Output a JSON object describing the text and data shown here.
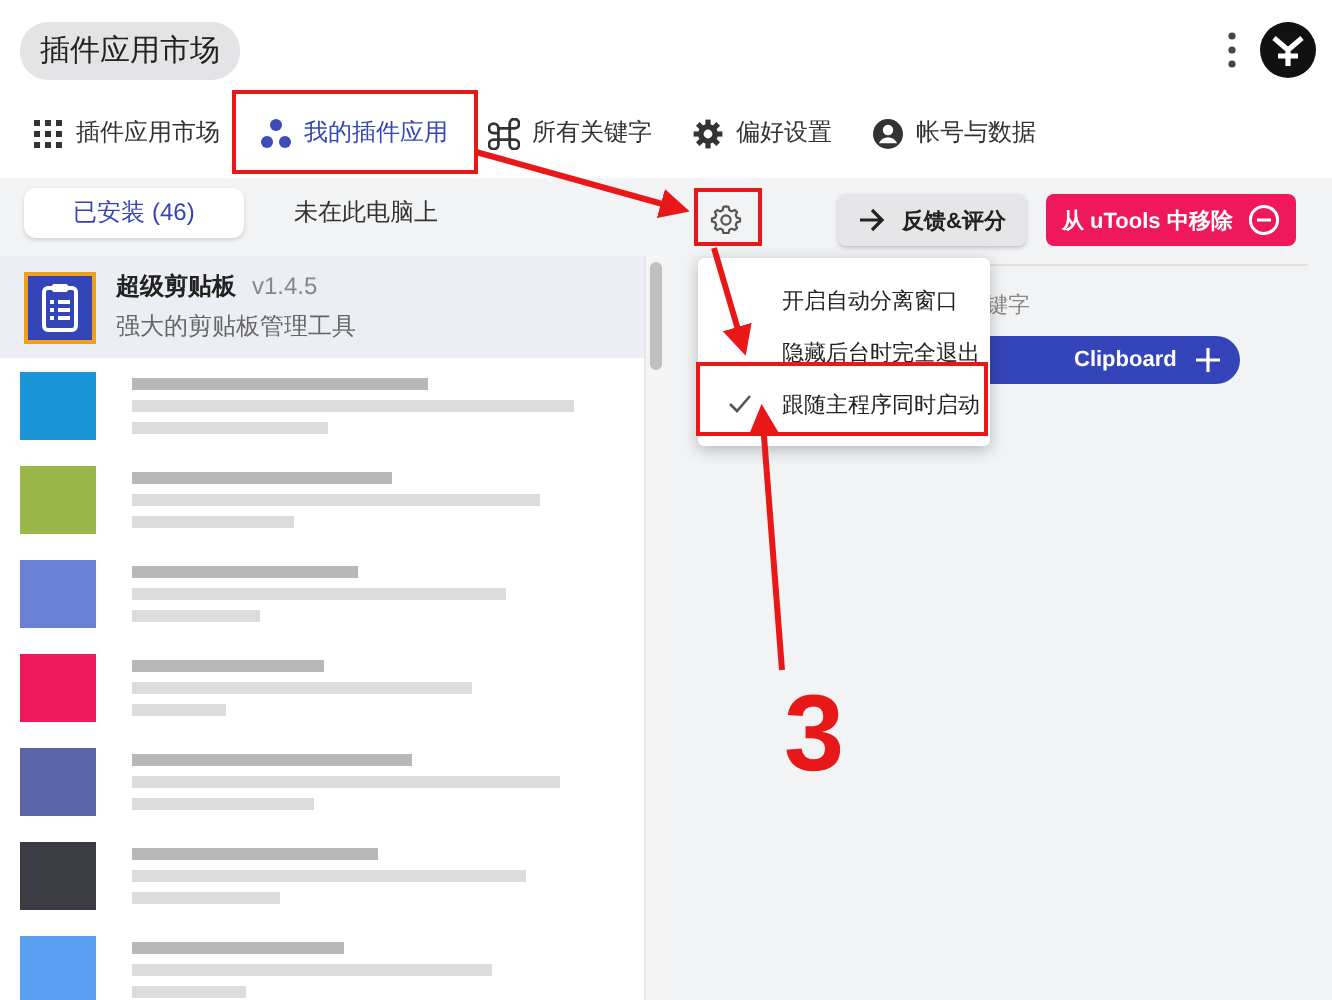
{
  "header": {
    "title": "插件应用市场"
  },
  "tabs": [
    {
      "label": "插件应用市场",
      "kind": "grid",
      "selected": false
    },
    {
      "label": "我的插件应用",
      "kind": "dots",
      "selected": true
    },
    {
      "label": "所有关键字",
      "kind": "command",
      "selected": false
    },
    {
      "label": "偏好设置",
      "kind": "gear",
      "selected": false
    },
    {
      "label": "帐号与数据",
      "kind": "person",
      "selected": false
    }
  ],
  "left_panel": {
    "segments": [
      {
        "label": "已安装 (46)",
        "selected": true
      },
      {
        "label": "未在此电脑上",
        "selected": false
      }
    ],
    "plugins": [
      {
        "name": "超级剪贴板",
        "version": "v1.4.5",
        "description": "强大的剪贴板管理工具",
        "selected": true
      }
    ],
    "blurred_items": [
      {
        "color": "#1a96d8"
      },
      {
        "color": "#9ab84a"
      },
      {
        "color": "#6a80d4"
      },
      {
        "color": "#f0185c"
      },
      {
        "color": "#5a64a8"
      },
      {
        "color": "#3c3c44"
      },
      {
        "color": "#5aa0f0"
      }
    ]
  },
  "detail": {
    "feedback_button": "反馈&评分",
    "remove_button": "从 uTools 中移除",
    "keywords_label": "键字",
    "keyword_chip": "Clipboard"
  },
  "settings_menu": {
    "items": [
      {
        "label": "开启自动分离窗口",
        "checked": false
      },
      {
        "label": "隐藏后台时完全退出",
        "checked": false
      },
      {
        "label": "跟随主程序同时启动",
        "checked": true
      }
    ]
  },
  "annotation": {
    "step": "3"
  }
}
